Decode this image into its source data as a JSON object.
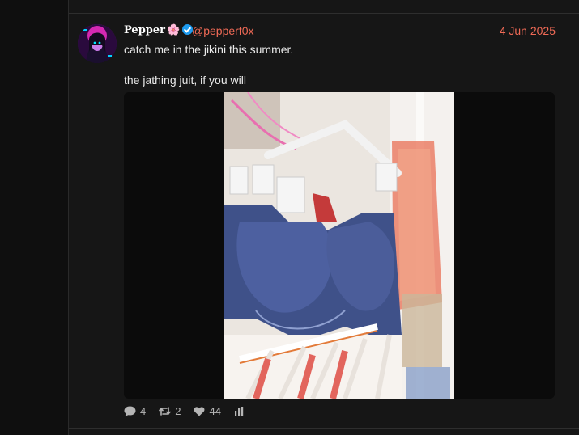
{
  "post": {
    "display_name": "Pepper",
    "flower": "🌸",
    "handle": "@pepperf0x",
    "date": "4 Jun 2025",
    "text_line1": "catch me in the jikini this summer.",
    "text_line2": "the jathing juit, if you will",
    "stats": {
      "replies": "4",
      "reposts": "2",
      "likes": "44"
    }
  },
  "colors": {
    "accent": "#f06a56",
    "verified": "#1d9bf0",
    "background": "#161616"
  },
  "icons": [
    "verified-badge-icon",
    "reply-icon",
    "repost-icon",
    "heart-icon",
    "analytics-icon"
  ]
}
